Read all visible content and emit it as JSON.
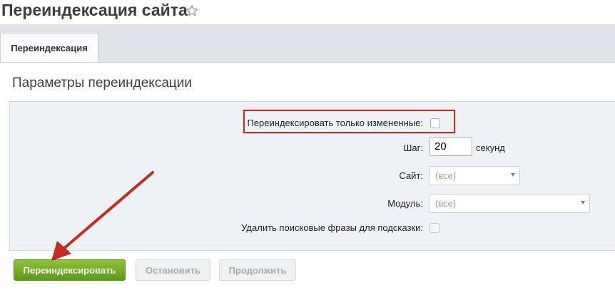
{
  "page": {
    "title": "Переиндексация сайта"
  },
  "tabs": [
    {
      "label": "Переиндексация",
      "active": true
    }
  ],
  "section": {
    "title": "Параметры переиндексации"
  },
  "form": {
    "reindex_changed_label": "Переиндексировать только измененные:",
    "reindex_changed_checked": false,
    "step_label": "Шаг:",
    "step_value": "20",
    "step_unit": "секунд",
    "site_label": "Сайт:",
    "site_value": "(все)",
    "module_label": "Модуль:",
    "module_value": "(все)",
    "delete_phrases_label": "Удалить поисковые фразы для подсказки:",
    "delete_phrases_checked": false
  },
  "buttons": {
    "reindex": "Переиндексировать",
    "stop": "Остановить",
    "continue": "Продолжить"
  },
  "colors": {
    "accent_green": "#6fae24",
    "annotation_red": "#c42b22"
  },
  "icons": {
    "favorite": "star-icon",
    "dropdown": "chevron-down-icon"
  }
}
